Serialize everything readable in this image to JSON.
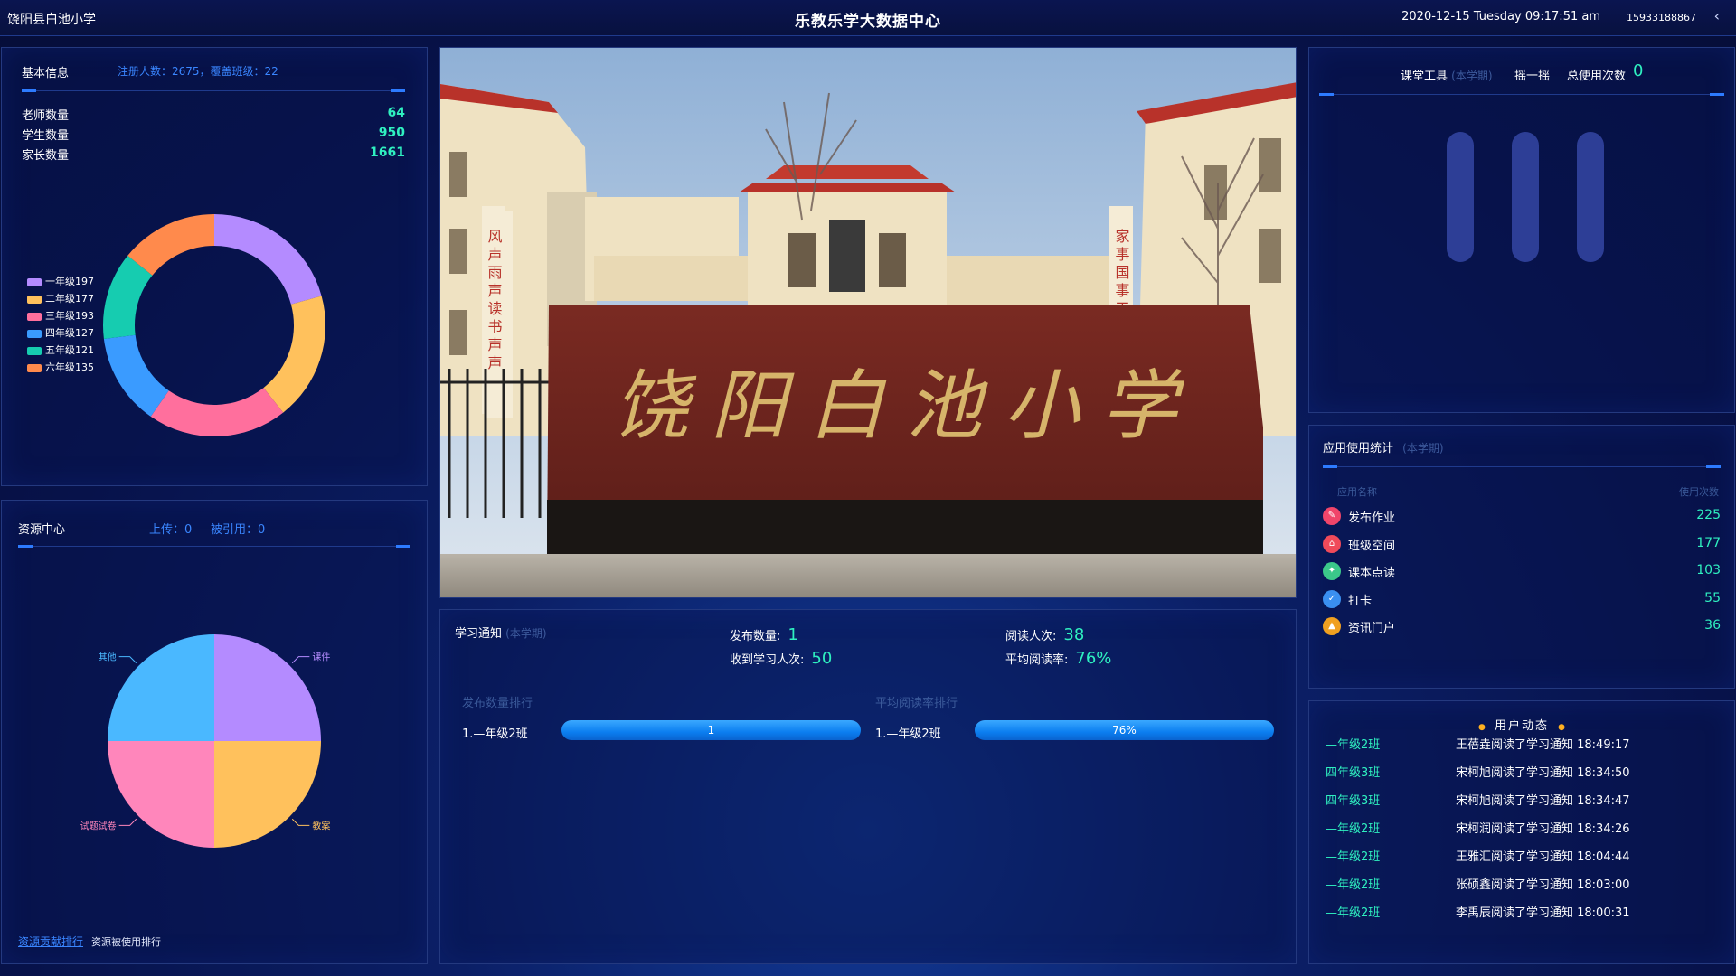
{
  "header": {
    "school_name": "饶阳县白池小学",
    "title": "乐教乐学大数据中心",
    "datetime": "2020-12-15 Tuesday 09:17:51 am",
    "phone": "15933188867"
  },
  "basic_info": {
    "title": "基本信息",
    "summary": "注册人数：2675，覆盖班级：22",
    "stats": [
      {
        "label": "老师数量",
        "value": "64"
      },
      {
        "label": "学生数量",
        "value": "950"
      },
      {
        "label": "家长数量",
        "value": "1661"
      }
    ],
    "chart_data": {
      "type": "pie",
      "donut": true,
      "categories": [
        "一年级",
        "二年级",
        "三年级",
        "四年级",
        "五年级",
        "六年级"
      ],
      "values": [
        197,
        177,
        193,
        127,
        121,
        135
      ],
      "legend_labels": [
        "一年级197",
        "二年级177",
        "三年级193",
        "四年级127",
        "五年级121",
        "六年级135"
      ],
      "colors": [
        "#b48bff",
        "#ffc15c",
        "#ff6f9d",
        "#3a9bff",
        "#16ccb0",
        "#ff8a4c"
      ],
      "legend_position": "left"
    }
  },
  "resource_center": {
    "title": "资源中心",
    "upload": "上传：0",
    "cited": "被引用：0",
    "chart_data": {
      "type": "pie",
      "categories": [
        "课件",
        "教案",
        "试题试卷",
        "其他"
      ],
      "values": [
        25,
        25,
        25,
        25
      ],
      "colors": [
        "#b48bff",
        "#ffc15c",
        "#ff86bb",
        "#4ab8ff"
      ]
    },
    "footer_link": "资源贡献排行",
    "footer_text": "资源被使用排行"
  },
  "notice": {
    "title": "学习通知",
    "term": "(本学期)",
    "published_label": "发布数量:",
    "published_value": "1",
    "readers_label": "阅读人次:",
    "readers_value": "38",
    "received_label": "收到学习人次:",
    "received_value": "50",
    "read_rate_label": "平均阅读率:",
    "read_rate_value": "76%",
    "rank_publish_title": "发布数量排行",
    "rank_read_title": "平均阅读率排行",
    "rank_publish": [
      {
        "name": "1.—年级2班",
        "value": "1"
      }
    ],
    "rank_read": [
      {
        "name": "1.—年级2班",
        "value": "76%"
      }
    ]
  },
  "classroom_tools": {
    "title": "课堂工具",
    "term": "(本学期)",
    "shake": "摇一摇",
    "total_label": "总使用次数",
    "total_value": "0"
  },
  "app_usage": {
    "title": "应用使用统计",
    "term": "(本学期)",
    "col_name": "应用名称",
    "col_count": "使用次数",
    "items": [
      {
        "name": "发布作业",
        "count": "225",
        "icon": "homework-icon",
        "color": "#f0456a"
      },
      {
        "name": "班级空间",
        "count": "177",
        "icon": "class-space-icon",
        "color": "#f04a5a"
      },
      {
        "name": "课本点读",
        "count": "103",
        "icon": "textbook-icon",
        "color": "#3bc88a"
      },
      {
        "name": "打卡",
        "count": "55",
        "icon": "checkin-icon",
        "color": "#3a8ff0"
      },
      {
        "name": "资讯门户",
        "count": "36",
        "icon": "portal-icon",
        "color": "#f0a020"
      }
    ]
  },
  "user_feed": {
    "title": "用户动态",
    "items": [
      {
        "cls": "—年级2班",
        "msg": "王蓓垚阅读了学习通知 18:49:17"
      },
      {
        "cls": "四年级3班",
        "msg": "宋柯旭阅读了学习通知 18:34:50"
      },
      {
        "cls": "四年级3班",
        "msg": "宋柯旭阅读了学习通知 18:34:47"
      },
      {
        "cls": "—年级2班",
        "msg": "宋柯润阅读了学习通知 18:34:26"
      },
      {
        "cls": "—年级2班",
        "msg": "王雅汇阅读了学习通知 18:04:44"
      },
      {
        "cls": "—年级2班",
        "msg": "张硕鑫阅读了学习通知 18:03:00"
      },
      {
        "cls": "—年级2班",
        "msg": "李禹辰阅读了学习通知 18:00:31"
      }
    ]
  },
  "photo": {
    "sign_text": "饶阳白池小学",
    "left_banner": "风声雨声读书声声",
    "right_banner": "家事国事天下事"
  }
}
